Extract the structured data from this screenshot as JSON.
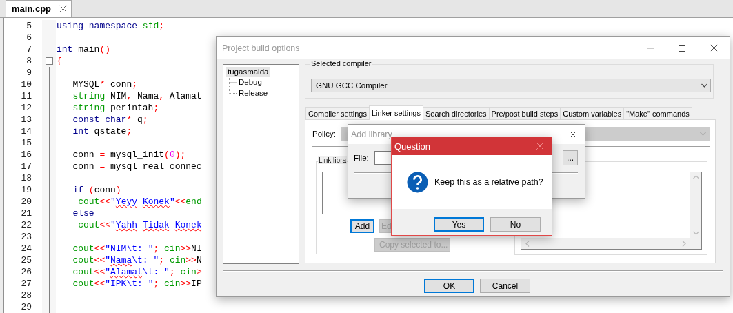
{
  "editor": {
    "tabs": [
      {
        "label": "main.cpp",
        "selected": true
      }
    ],
    "lines": [
      {
        "number": "5",
        "segments": [
          {
            "kind": "keyword",
            "text": "using namespace "
          },
          {
            "kind": "type",
            "text": "std"
          },
          {
            "kind": "op",
            "text": ";"
          }
        ]
      },
      {
        "number": "6"
      },
      {
        "number": "7",
        "segments": [
          {
            "kind": "keyword",
            "text": "int "
          },
          {
            "kind": "ident",
            "text": "main"
          },
          {
            "kind": "op",
            "text": "()"
          }
        ]
      },
      {
        "number": "8",
        "folded": false,
        "segments": [
          {
            "kind": "op",
            "text": "{"
          }
        ]
      },
      {
        "number": "9"
      },
      {
        "number": "10",
        "segments": [
          {
            "kind": "ident",
            "text": "   MYSQL"
          },
          {
            "kind": "op",
            "text": "*"
          },
          {
            "kind": "ident",
            "text": " conn"
          },
          {
            "kind": "op",
            "text": ";"
          }
        ]
      },
      {
        "number": "11",
        "segments": [
          {
            "kind": "type",
            "text": "   string "
          },
          {
            "kind": "ident",
            "text": "NIM"
          },
          {
            "kind": "op",
            "text": ","
          },
          {
            "kind": "ident",
            "text": " Nama"
          },
          {
            "kind": "op",
            "text": ","
          },
          {
            "kind": "ident",
            "text": " Alamat"
          }
        ]
      },
      {
        "number": "12",
        "segments": [
          {
            "kind": "type",
            "text": "   string "
          },
          {
            "kind": "ident",
            "text": "perintah"
          },
          {
            "kind": "op",
            "text": ";"
          }
        ]
      },
      {
        "number": "13",
        "segments": [
          {
            "kind": "keyword",
            "text": "   const char"
          },
          {
            "kind": "op",
            "text": "*"
          },
          {
            "kind": "ident",
            "text": " q"
          },
          {
            "kind": "op",
            "text": ";"
          }
        ]
      },
      {
        "number": "14",
        "segments": [
          {
            "kind": "keyword",
            "text": "   int "
          },
          {
            "kind": "ident",
            "text": "qstate"
          },
          {
            "kind": "op",
            "text": ";"
          }
        ]
      },
      {
        "number": "15"
      },
      {
        "number": "16",
        "segments": [
          {
            "kind": "ident",
            "text": "   conn "
          },
          {
            "kind": "op",
            "text": "="
          },
          {
            "kind": "ident",
            "text": " mysql_init"
          },
          {
            "kind": "op",
            "text": "("
          },
          {
            "kind": "number",
            "text": "0"
          },
          {
            "kind": "op",
            "text": ");"
          }
        ]
      },
      {
        "number": "17",
        "segments": [
          {
            "kind": "ident",
            "text": "   conn "
          },
          {
            "kind": "op",
            "text": "="
          },
          {
            "kind": "ident",
            "text": " mysql_real_connec"
          }
        ]
      },
      {
        "number": "18"
      },
      {
        "number": "19",
        "segments": [
          {
            "kind": "keyword",
            "text": "   if "
          },
          {
            "kind": "op",
            "text": "("
          },
          {
            "kind": "ident",
            "text": "conn"
          },
          {
            "kind": "op",
            "text": ")"
          }
        ]
      },
      {
        "number": "20",
        "segments": [
          {
            "kind": "type",
            "text": "    cout"
          },
          {
            "kind": "op",
            "text": "<<"
          },
          {
            "kind": "string",
            "text": "\""
          },
          {
            "kind": "string",
            "text": "Yeyy ",
            "misspelled": true
          },
          {
            "kind": "string",
            "text": "Konek",
            "misspelled": true
          },
          {
            "kind": "string",
            "text": "\""
          },
          {
            "kind": "op",
            "text": "<<"
          },
          {
            "kind": "type",
            "text": "end"
          }
        ]
      },
      {
        "number": "21",
        "segments": [
          {
            "kind": "keyword",
            "text": "   else"
          }
        ]
      },
      {
        "number": "22",
        "segments": [
          {
            "kind": "type",
            "text": "    cout"
          },
          {
            "kind": "op",
            "text": "<<"
          },
          {
            "kind": "string",
            "text": "\""
          },
          {
            "kind": "string",
            "text": "Yahh ",
            "misspelled": true
          },
          {
            "kind": "string",
            "text": "Tidak ",
            "misspelled": true
          },
          {
            "kind": "string",
            "text": "Konek",
            "misspelled": true
          }
        ]
      },
      {
        "number": "23"
      },
      {
        "number": "24",
        "segments": [
          {
            "kind": "type",
            "text": "   cout"
          },
          {
            "kind": "op",
            "text": "<<"
          },
          {
            "kind": "string",
            "text": "\"NIM\\t: \""
          },
          {
            "kind": "op",
            "text": ";"
          },
          {
            "kind": "type",
            "text": " cin"
          },
          {
            "kind": "op",
            "text": ">>"
          },
          {
            "kind": "ident",
            "text": "NI"
          }
        ]
      },
      {
        "number": "25",
        "segments": [
          {
            "kind": "type",
            "text": "   cout"
          },
          {
            "kind": "op",
            "text": "<<"
          },
          {
            "kind": "string",
            "text": "\""
          },
          {
            "kind": "string",
            "text": "Nama",
            "misspelled": true
          },
          {
            "kind": "string",
            "text": "\\t: \""
          },
          {
            "kind": "op",
            "text": ";"
          },
          {
            "kind": "type",
            "text": " cin"
          },
          {
            "kind": "op",
            "text": ">>"
          },
          {
            "kind": "ident",
            "text": "N"
          }
        ]
      },
      {
        "number": "26",
        "segments": [
          {
            "kind": "type",
            "text": "   cout"
          },
          {
            "kind": "op",
            "text": "<<"
          },
          {
            "kind": "string",
            "text": "\""
          },
          {
            "kind": "string",
            "text": "Alamat",
            "misspelled": true
          },
          {
            "kind": "string",
            "text": "\\t: \""
          },
          {
            "kind": "op",
            "text": ";"
          },
          {
            "kind": "type",
            "text": " cin"
          },
          {
            "kind": "op",
            "text": ">"
          }
        ]
      },
      {
        "number": "27",
        "segments": [
          {
            "kind": "type",
            "text": "   cout"
          },
          {
            "kind": "op",
            "text": "<<"
          },
          {
            "kind": "string",
            "text": "\"IPK\\t: \""
          },
          {
            "kind": "op",
            "text": ";"
          },
          {
            "kind": "type",
            "text": " cin"
          },
          {
            "kind": "op",
            "text": ">>"
          },
          {
            "kind": "ident",
            "text": "IP"
          }
        ]
      },
      {
        "number": "28"
      },
      {
        "number": "29"
      }
    ]
  },
  "build_options": {
    "title": "Project build options",
    "active": false,
    "tree": [
      {
        "label": "tugasmaida",
        "selected": true,
        "children": [
          {
            "label": "Debug",
            "selected": false
          },
          {
            "label": "Release",
            "selected": false
          }
        ]
      }
    ],
    "compiler": {
      "label": "Selected compiler",
      "value": "GNU GCC Compiler"
    },
    "tabs": [
      {
        "label": "Compiler settings",
        "selected": false
      },
      {
        "label": "Linker settings",
        "selected": true
      },
      {
        "label": "Search directories",
        "selected": false
      },
      {
        "label": "Pre/post build steps",
        "selected": false
      },
      {
        "label": "Custom variables",
        "selected": false
      },
      {
        "label": "\"Make\" commands",
        "selected": false
      }
    ],
    "policy": {
      "label": "Policy:",
      "disabled": true
    },
    "link_libraries": {
      "label": "Link libra",
      "buttons": [
        {
          "label": "Add",
          "focused": true,
          "disabled": false
        },
        {
          "label": "Ed",
          "focused": false,
          "disabled": true
        }
      ],
      "copy_button": {
        "label": "Copy selected to...",
        "disabled": true
      }
    },
    "buttons": [
      {
        "label": "OK",
        "default": true
      },
      {
        "label": "Cancel",
        "default": false
      }
    ]
  },
  "add_library": {
    "title": "Add library",
    "active": false,
    "file_label": "File:",
    "browse_button": "..."
  },
  "question": {
    "title": "Question",
    "active": true,
    "message": "Keep this as a relative path?",
    "buttons": [
      {
        "label": "Yes",
        "default": true
      },
      {
        "label": "No",
        "default": false
      }
    ]
  }
}
